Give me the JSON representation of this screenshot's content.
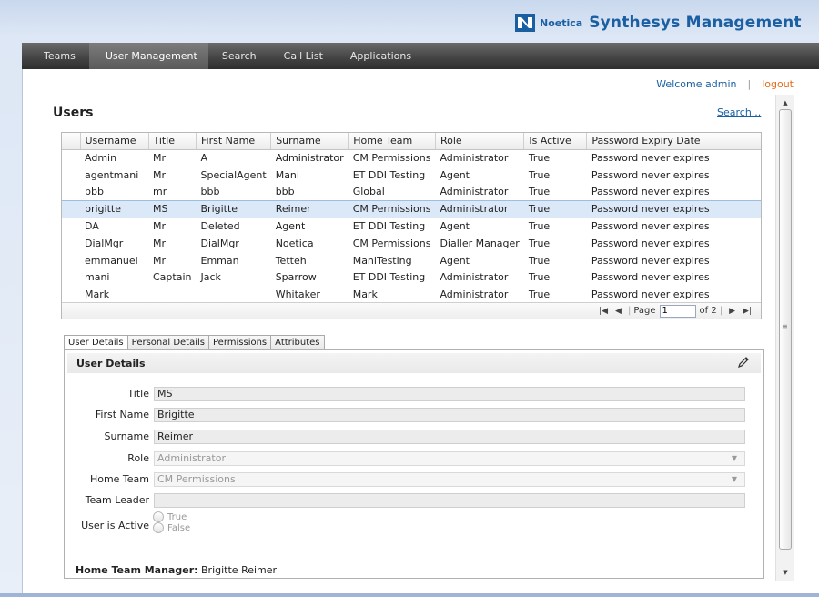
{
  "brand": {
    "small": "Noetica",
    "big": "Synthesys Management"
  },
  "nav": [
    {
      "label": "Teams"
    },
    {
      "label": "User Management",
      "active": true
    },
    {
      "label": "Search"
    },
    {
      "label": "Call List"
    },
    {
      "label": "Applications"
    }
  ],
  "welcome": {
    "text": "Welcome admin",
    "separator": "|",
    "logout": "logout"
  },
  "users": {
    "title": "Users",
    "search_link": "Search..."
  },
  "grid": {
    "columns": [
      "Username",
      "Title",
      "First Name",
      "Surname",
      "Home Team",
      "Role",
      "Is Active",
      "Password Expiry Date"
    ],
    "rows": [
      [
        "Admin",
        "Mr",
        "A",
        "Administrator",
        "CM Permissions",
        "Administrator",
        "True",
        "Password never expires"
      ],
      [
        "agentmani",
        "Mr",
        "SpecialAgent",
        "Mani",
        "ET DDI Testing",
        "Agent",
        "True",
        "Password never expires"
      ],
      [
        "bbb",
        "mr",
        "bbb",
        "bbb",
        "Global",
        "Administrator",
        "True",
        "Password never expires"
      ],
      [
        "brigitte",
        "MS",
        "Brigitte",
        "Reimer",
        "CM Permissions",
        "Administrator",
        "True",
        "Password never expires"
      ],
      [
        "DA",
        "Mr",
        "Deleted",
        "Agent",
        "ET DDI Testing",
        "Agent",
        "True",
        "Password never expires"
      ],
      [
        "DialMgr",
        "Mr",
        "DialMgr",
        "Noetica",
        "CM Permissions",
        "Dialler Manager",
        "True",
        "Password never expires"
      ],
      [
        "emmanuel",
        "Mr",
        "Emman",
        "Tetteh",
        "ManiTesting",
        "Agent",
        "True",
        "Password never expires"
      ],
      [
        "mani",
        "Captain",
        "Jack",
        "Sparrow",
        "ET DDI Testing",
        "Administrator",
        "True",
        "Password never expires"
      ],
      [
        "Mark",
        "",
        "",
        "Whitaker",
        "Mark",
        "Administrator",
        "True",
        "Password never expires"
      ]
    ],
    "selected_row": 3,
    "pager": {
      "page_label": "Page",
      "page_value": "1",
      "of_label": "of 2"
    }
  },
  "tabs": [
    {
      "label": "User Details",
      "active": true
    },
    {
      "label": "Personal Details"
    },
    {
      "label": "Permissions"
    },
    {
      "label": "Attributes"
    }
  ],
  "details": {
    "section_title": "User Details",
    "fields": {
      "title": {
        "label": "Title",
        "value": "MS"
      },
      "first_name": {
        "label": "First Name",
        "value": "Brigitte"
      },
      "surname": {
        "label": "Surname",
        "value": "Reimer"
      },
      "role": {
        "label": "Role",
        "value": "Administrator"
      },
      "home_team": {
        "label": "Home Team",
        "value": "CM Permissions"
      },
      "team_leader": {
        "label": "Team Leader",
        "value": ""
      },
      "user_is_active": {
        "label": "User is Active",
        "options": [
          "True",
          "False"
        ]
      }
    },
    "home_team_manager": {
      "label": "Home Team Manager:",
      "value": "Brigitte Reimer"
    }
  },
  "colors": {
    "brand": "#1b5fa3",
    "logout": "#e06a1a",
    "selected_row": "#dbe8f8",
    "navbar": "#454545"
  },
  "icons": {
    "edit": "pencil-icon",
    "logo": "noetica-logo-icon"
  }
}
